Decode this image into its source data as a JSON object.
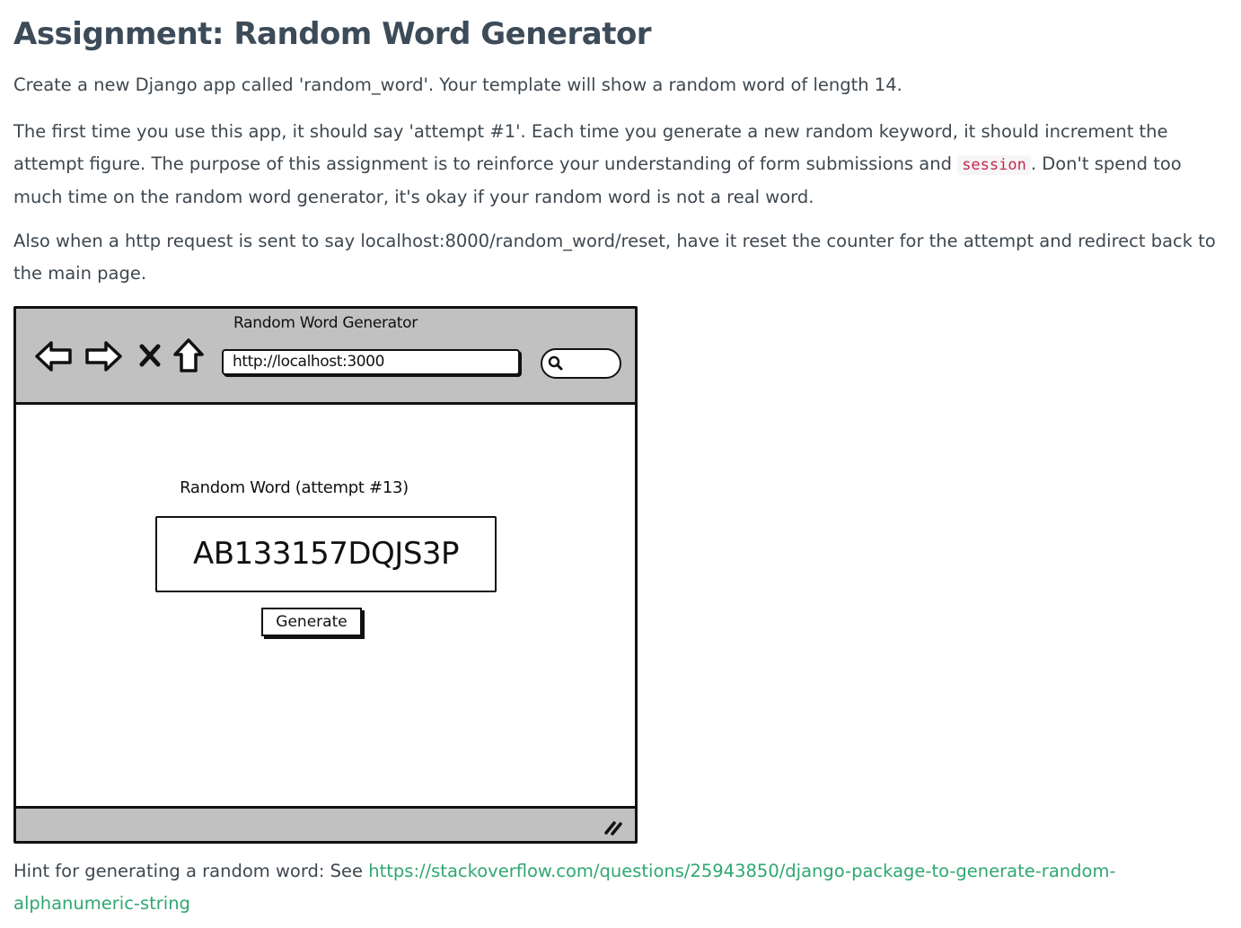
{
  "heading": "Assignment: Random Word Generator",
  "paragraph1": "Create a new Django app called 'random_word'. Your template will show a random word of length 14.",
  "paragraph2": {
    "before": "The first time you use this app, it should say 'attempt #1'. Each time you generate a new random keyword, it should increment the attempt figure. The purpose of this assignment is to reinforce your understanding of form submissions and ",
    "code": "session",
    "after": ". Don't spend too much time on the random word generator, it's okay if your random word is not a real word."
  },
  "paragraph3": "Also when a http request is sent to say localhost:8000/random_word/reset, have it reset the counter for the attempt and redirect back to the main page.",
  "mockup": {
    "window_title": "Random Word Generator",
    "url": "http://localhost:3000",
    "word_label": "Random Word (attempt #13)",
    "word": "AB133157DQJS3P",
    "generate_label": "Generate",
    "icons": [
      "back-arrow-icon",
      "forward-arrow-icon",
      "close-x-icon",
      "home-icon",
      "search-icon",
      "resize-grip-icon"
    ]
  },
  "hint": {
    "text": "Hint for generating a random word: See ",
    "link": "https://stackoverflow.com/questions/25943850/django-package-to-generate-random-alphanumeric-string"
  },
  "colors": {
    "heading": "#3d4b59",
    "body_text": "#3e474f",
    "link": "#2fa772",
    "code": "#c7254e",
    "mockup_chrome": "#c1c1c1"
  }
}
